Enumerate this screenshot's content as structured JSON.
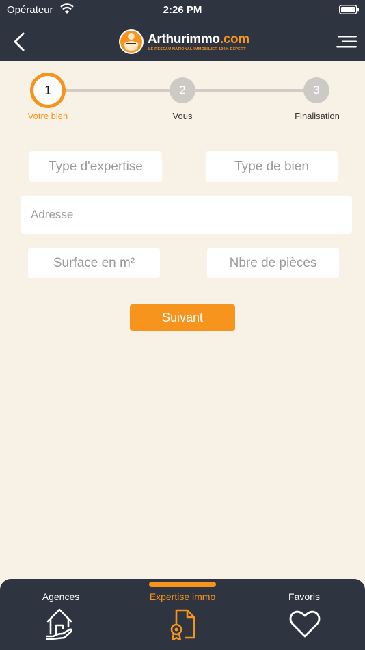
{
  "status_bar": {
    "carrier": "Opérateur",
    "time": "2:26 PM"
  },
  "header": {
    "logo_name_main": "Arthurimmo",
    "logo_name_accent": ".com",
    "logo_tagline": "LE RESEAU NATIONAL IMMOBILIER 100% EXPERT"
  },
  "stepper": {
    "steps": [
      {
        "number": "1",
        "label": "Votre bien",
        "state": "active"
      },
      {
        "number": "2",
        "label": "Vous",
        "state": "inactive"
      },
      {
        "number": "3",
        "label": "Finalisation",
        "state": "inactive"
      }
    ]
  },
  "form": {
    "type_expertise": "Type d'expertise",
    "type_bien": "Type de bien",
    "adresse": "Adresse",
    "surface": "Surface en m²",
    "nbre_pieces": "Nbre de pièces",
    "submit_label": "Suivant"
  },
  "tabbar": {
    "tabs": [
      {
        "label": "Agences",
        "icon": "house-hand-icon",
        "active": false
      },
      {
        "label": "Expertise immo",
        "icon": "certificate-document-icon",
        "active": true
      },
      {
        "label": "Favoris",
        "icon": "heart-icon",
        "active": false
      }
    ]
  },
  "colors": {
    "accent": "#f7941d",
    "dark": "#2f3540",
    "background": "#f8f1e5"
  }
}
